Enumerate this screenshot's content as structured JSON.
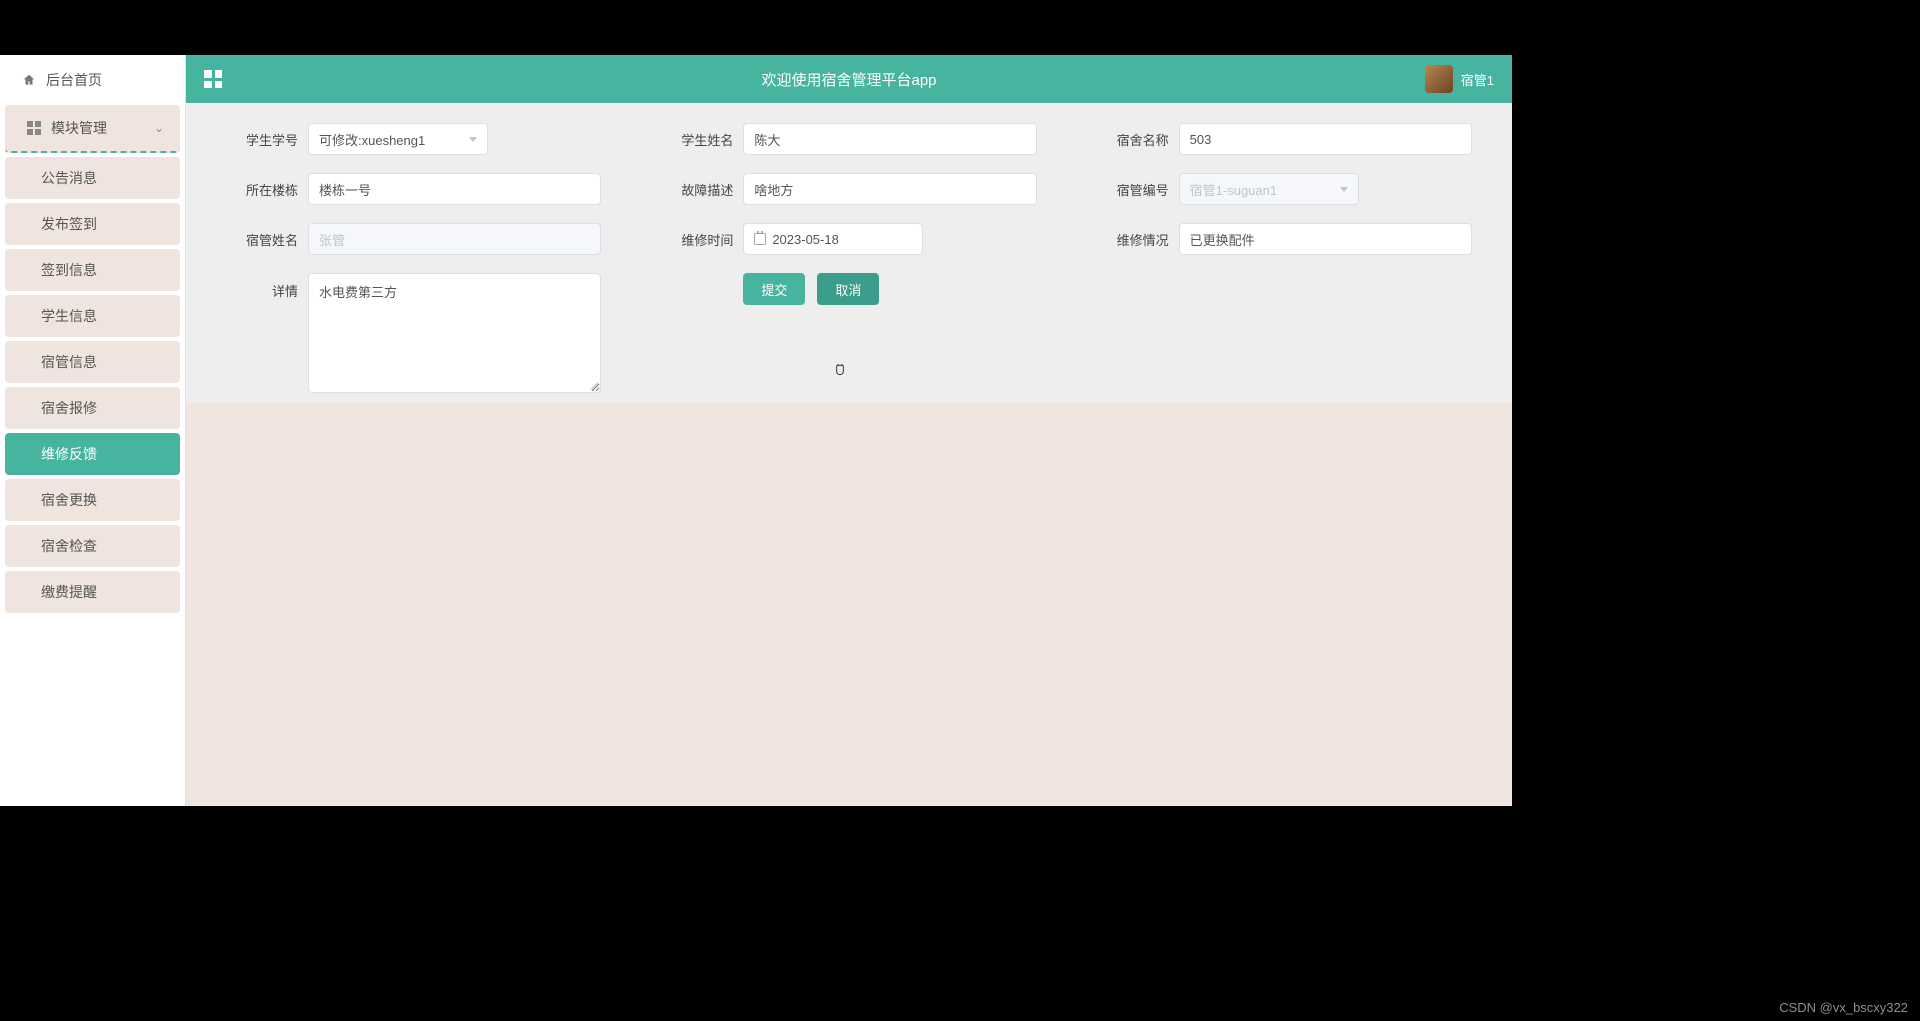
{
  "sidebar": {
    "home": "后台首页",
    "group": "模块管理",
    "items": [
      {
        "label": "公告消息"
      },
      {
        "label": "发布签到"
      },
      {
        "label": "签到信息"
      },
      {
        "label": "学生信息"
      },
      {
        "label": "宿管信息"
      },
      {
        "label": "宿舍报修"
      },
      {
        "label": "维修反馈"
      },
      {
        "label": "宿舍更换"
      },
      {
        "label": "宿舍检查"
      },
      {
        "label": "缴费提醒"
      }
    ]
  },
  "topbar": {
    "title": "欢迎使用宿舍管理平台app",
    "username": "宿管1"
  },
  "form": {
    "student_id": {
      "label": "学生学号",
      "value": "可修改:xuesheng1"
    },
    "student_name": {
      "label": "学生姓名",
      "value": "陈大"
    },
    "dorm_name": {
      "label": "宿舍名称",
      "value": "503"
    },
    "building": {
      "label": "所在楼栋",
      "value": "楼栋一号"
    },
    "fault_desc": {
      "label": "故障描述",
      "value": "啥地方"
    },
    "manager_no": {
      "label": "宿管编号",
      "value": "宿管1-suguan1"
    },
    "manager_name": {
      "label": "宿管姓名",
      "value": "张管"
    },
    "repair_time": {
      "label": "维修时间",
      "value": "2023-05-18"
    },
    "repair_status": {
      "label": "维修情况",
      "value": "已更换配件"
    },
    "detail": {
      "label": "详情",
      "value": "水电费第三方"
    }
  },
  "buttons": {
    "submit": "提交",
    "cancel": "取消"
  },
  "watermark": "CSDN @vx_bscxy322"
}
